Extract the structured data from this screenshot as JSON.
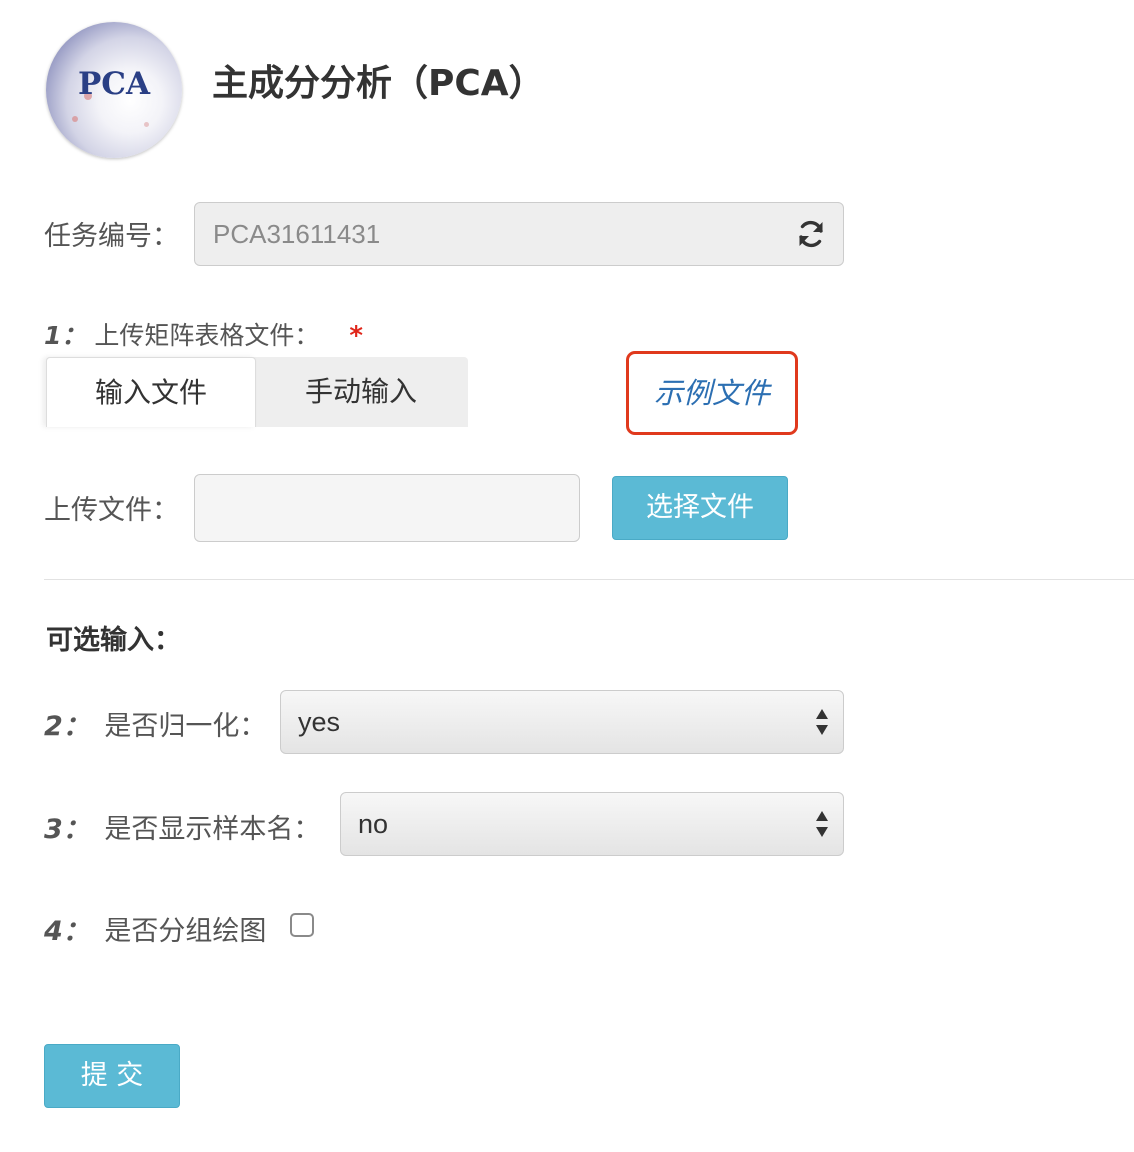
{
  "header": {
    "logo_text": "PCA",
    "title": "主成分分析（PCA）"
  },
  "task": {
    "label": "任务编号：",
    "value": "PCA31611431",
    "refresh_icon": "refresh-icon"
  },
  "upload_matrix": {
    "number": "1：",
    "label": "上传矩阵表格文件：",
    "required_mark": "*",
    "tabs": [
      {
        "label": "输入文件",
        "active": true
      },
      {
        "label": "手动输入",
        "active": false
      }
    ],
    "example_link": "示例文件",
    "example_highlight_color": "#e0391d"
  },
  "upload_file": {
    "label": "上传文件：",
    "value": "",
    "button_label": "选择文件"
  },
  "optional": {
    "title": "可选输入：",
    "normalize": {
      "number": "2：",
      "label": "是否归一化：",
      "selected": "yes"
    },
    "show_sample_names": {
      "number": "3：",
      "label": "是否显示样本名：",
      "selected": "no"
    },
    "group_plot": {
      "number": "4：",
      "label": "是否分组绘图",
      "checked": false
    }
  },
  "submit": {
    "label": "提 交"
  },
  "colors": {
    "accent_button": "#5bbad5",
    "link": "#2c6fb2",
    "required": "#e0261a"
  }
}
